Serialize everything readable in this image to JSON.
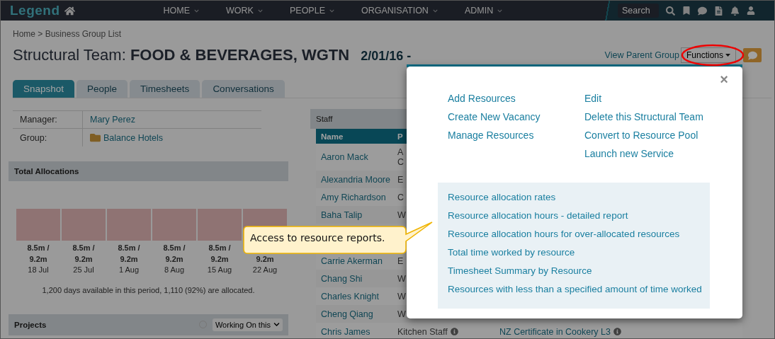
{
  "nav": {
    "logo": "Legend",
    "menu": [
      {
        "label": "HOME"
      },
      {
        "label": "WORK"
      },
      {
        "label": "PEOPLE"
      },
      {
        "label": "ORGANISATION"
      },
      {
        "label": "ADMIN"
      }
    ],
    "search": {
      "placeholder": "Search"
    }
  },
  "breadcrumb": "Home > Business Group List",
  "title": {
    "prefix": "Structural Team:",
    "name": "FOOD & BEVERAGES, WGTN",
    "date": "2/01/16 -"
  },
  "header_actions": {
    "link": "View Parent Group",
    "button": "Functions"
  },
  "tabs": [
    {
      "label": "Snapshot",
      "selected": true
    },
    {
      "label": "People",
      "selected": false
    },
    {
      "label": "Timesheets",
      "selected": false
    },
    {
      "label": "Conversations",
      "selected": false
    }
  ],
  "details": [
    {
      "label": "Manager:",
      "value": "Mary Perez",
      "kind": "person"
    },
    {
      "label": "Group:",
      "value": "Balance Hotels",
      "kind": "folder"
    }
  ],
  "allocations": {
    "title": "Total Allocations",
    "bars": [
      {
        "used": "8.5m /",
        "total": "9.2m",
        "week": "18 Jul"
      },
      {
        "used": "8.5m /",
        "total": "9.2m",
        "week": "25 Jul"
      },
      {
        "used": "8.5m /",
        "total": "9.2m",
        "week": "1 Aug"
      },
      {
        "used": "8.5m /",
        "total": "9.2m",
        "week": "8 Aug"
      },
      {
        "used": "8.5m /",
        "total": "9.2m",
        "week": "15 Aug"
      },
      {
        "total": "9.2m",
        "week": "22 Aug"
      }
    ],
    "summary": "1,200 days available in this period, 1,110 (92%) are allocated."
  },
  "projects": {
    "title": "Projects",
    "filter": "Working On this"
  },
  "staff": {
    "title": "Staff",
    "columns": [
      "Name",
      "P"
    ],
    "rows": [
      {
        "name": "Aaron Mack",
        "position": "A C"
      },
      {
        "name": "Alexandria Moore",
        "position": "E"
      },
      {
        "name": "Amy Richardson",
        "position": "C"
      },
      {
        "name": "Baha Talip",
        "position": "W"
      },
      {
        "name": "Carrie Akerman",
        "position": "E",
        "gap_before": true
      },
      {
        "name": "Chang Shi",
        "position": "W"
      },
      {
        "name": "Charles Knight",
        "position": "W"
      },
      {
        "name": "Cheng Qiang",
        "position": "W"
      },
      {
        "name": "Chris James",
        "position": "Kitchen Staff",
        "qualification": "NZ Certificate in Cookery L3"
      }
    ]
  },
  "modal": {
    "close": "×",
    "actions_left": [
      "Add Resources",
      "Create New Vacancy",
      "Manage Resources"
    ],
    "actions_right": [
      "Edit",
      "Delete this Structural Team",
      "Convert to Resource Pool",
      "Launch new Service"
    ],
    "reports": [
      "Resource allocation rates",
      "Resource allocation hours - detailed report",
      "Resource allocation hours for over-allocated resources",
      "Total time worked by resource",
      "Timesheet Summary by Resource",
      "Resources with less than a specified amount of time worked"
    ]
  },
  "callout": "Access to resource reports."
}
